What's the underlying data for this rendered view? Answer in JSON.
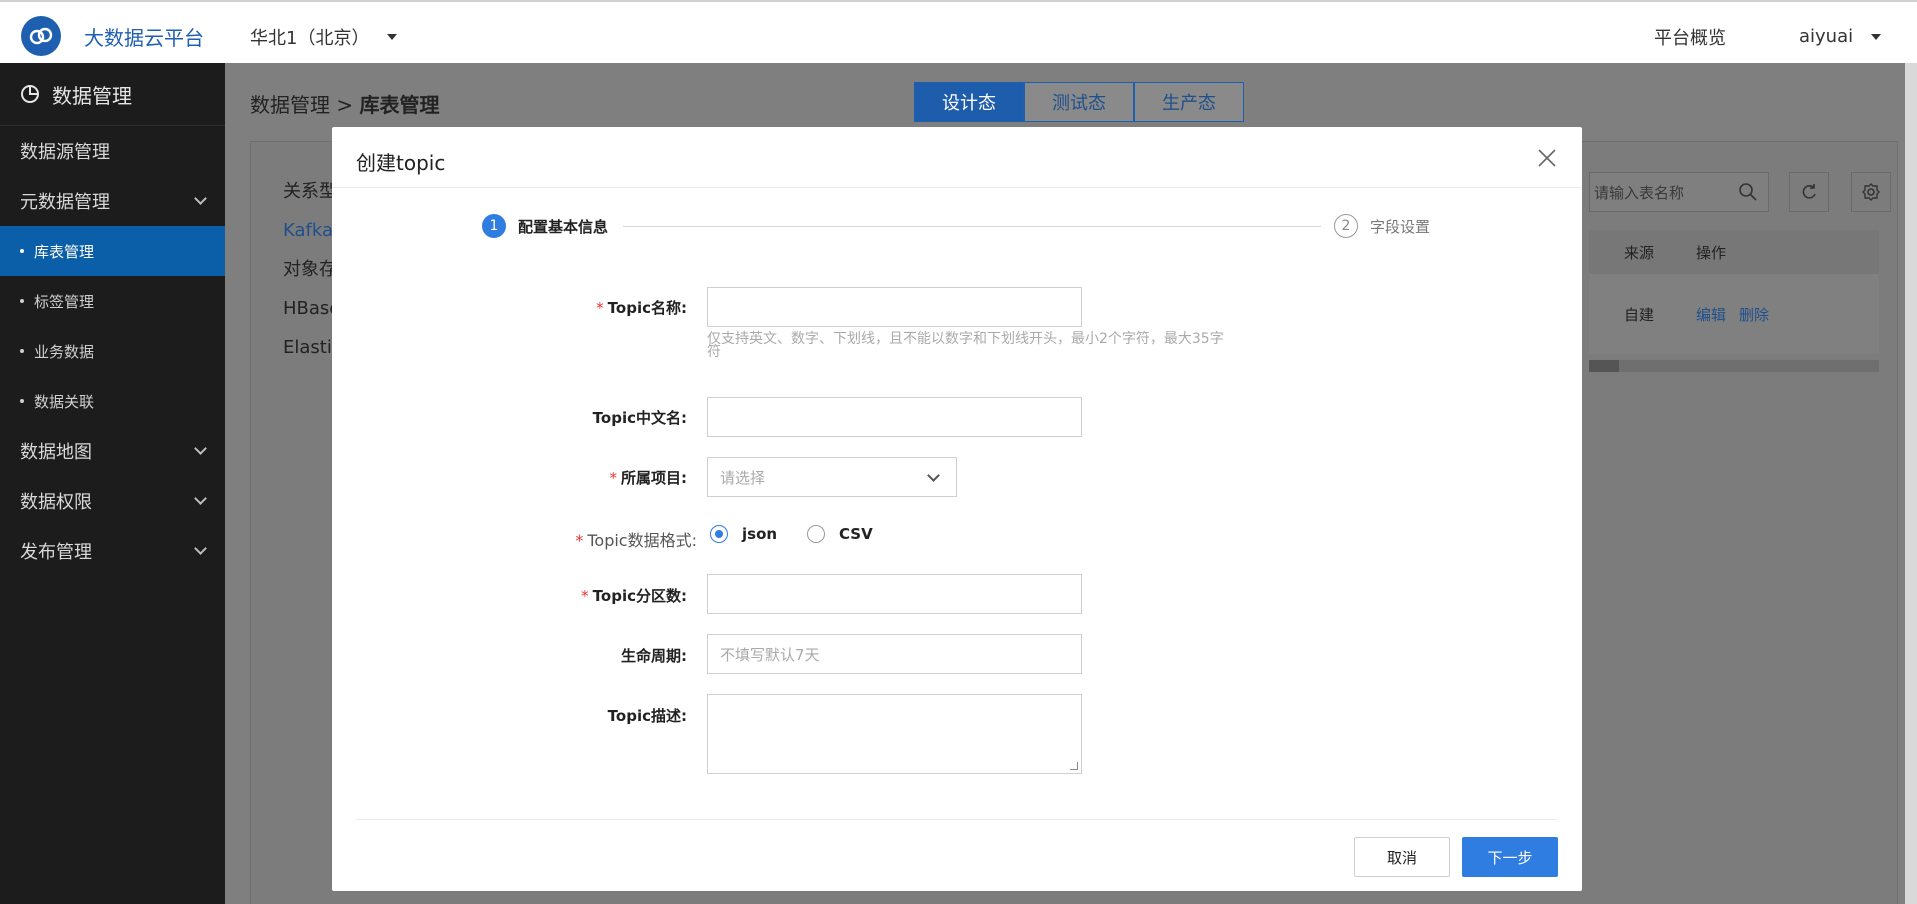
{
  "topbar": {
    "brand": "大数据云平台",
    "region": "华北1（北京）",
    "overview": "平台概览",
    "user": "aiyuai"
  },
  "sidebar": {
    "title": "数据管理",
    "items": [
      {
        "label": "数据源管理",
        "type": "item"
      },
      {
        "label": "元数据管理",
        "type": "group"
      },
      {
        "label": "库表管理",
        "type": "sub",
        "active": true
      },
      {
        "label": "标签管理",
        "type": "sub"
      },
      {
        "label": "业务数据",
        "type": "sub"
      },
      {
        "label": "数据关联",
        "type": "sub"
      },
      {
        "label": "数据地图",
        "type": "group"
      },
      {
        "label": "数据权限",
        "type": "group"
      },
      {
        "label": "发布管理",
        "type": "group"
      }
    ]
  },
  "main": {
    "crumb_parent": "数据管理",
    "crumb_sep": ">",
    "crumb_current": "库表管理",
    "states": [
      "设计态",
      "测试态",
      "生产态"
    ],
    "db_types": [
      "关系型",
      "Kafka",
      "对象存",
      "HBase",
      "Elastic"
    ],
    "search_placeholder": "请输入表名称",
    "table_headers": [
      "来源",
      "操作"
    ],
    "table_row": {
      "source": "自建",
      "edit": "编辑",
      "delete": "删除"
    }
  },
  "modal": {
    "title": "创建topic",
    "steps": [
      {
        "num": "1",
        "label": "配置基本信息"
      },
      {
        "num": "2",
        "label": "字段设置"
      }
    ],
    "fields": {
      "topic_name": {
        "label": "Topic名称:",
        "required": "*",
        "value": ""
      },
      "topic_name_hint": "仅支持英文、数字、下划线，且不能以数字和下划线开头，最小2个字符，最大35字符",
      "topic_cn_name": {
        "label": "Topic中文名:",
        "value": ""
      },
      "project": {
        "label": "所属项目:",
        "required": "*",
        "placeholder": "请选择"
      },
      "format": {
        "label": "Topic数据格式:",
        "required": "*",
        "options": [
          "json",
          "CSV"
        ],
        "selected": "json"
      },
      "partitions": {
        "label": "Topic分区数:",
        "required": "*",
        "value": ""
      },
      "lifecycle": {
        "label": "生命周期:",
        "placeholder": "不填写默认7天"
      },
      "description": {
        "label": "Topic描述:",
        "value": ""
      }
    },
    "buttons": {
      "cancel": "取消",
      "next": "下一步"
    }
  }
}
